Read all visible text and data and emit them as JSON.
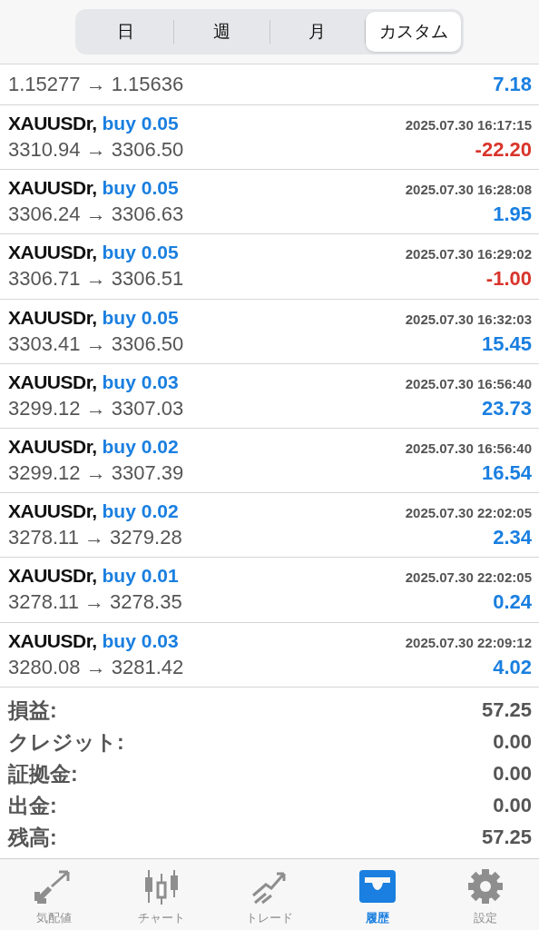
{
  "tabs": [
    {
      "label": "日",
      "selected": false
    },
    {
      "label": "週",
      "selected": false
    },
    {
      "label": "月",
      "selected": false
    },
    {
      "label": "カスタム",
      "selected": true
    }
  ],
  "deals": [
    {
      "prices": "1.15277 → 1.15636",
      "profit": "7.18",
      "color": "#1a7fe0"
    },
    {
      "symbol": "XAUUSDr,",
      "order": "buy 0.05",
      "time": "2025.07.30 16:17:15",
      "prices": "3310.94 → 3306.50",
      "profit": "-22.20",
      "color": "#d9342b"
    },
    {
      "symbol": "XAUUSDr,",
      "order": "buy 0.05",
      "time": "2025.07.30 16:28:08",
      "prices": "3306.24 → 3306.63",
      "profit": "1.95",
      "color": "#1a7fe0"
    },
    {
      "symbol": "XAUUSDr,",
      "order": "buy 0.05",
      "time": "2025.07.30 16:29:02",
      "prices": "3306.71 → 3306.51",
      "profit": "-1.00",
      "color": "#d9342b"
    },
    {
      "symbol": "XAUUSDr,",
      "order": "buy 0.05",
      "time": "2025.07.30 16:32:03",
      "prices": "3303.41 → 3306.50",
      "profit": "15.45",
      "color": "#1a7fe0"
    },
    {
      "symbol": "XAUUSDr,",
      "order": "buy 0.03",
      "time": "2025.07.30 16:56:40",
      "prices": "3299.12 → 3307.03",
      "profit": "23.73",
      "color": "#1a7fe0"
    },
    {
      "symbol": "XAUUSDr,",
      "order": "buy 0.02",
      "time": "2025.07.30 16:56:40",
      "prices": "3299.12 → 3307.39",
      "profit": "16.54",
      "color": "#1a7fe0"
    },
    {
      "symbol": "XAUUSDr,",
      "order": "buy 0.02",
      "time": "2025.07.30 22:02:05",
      "prices": "3278.11 → 3279.28",
      "profit": "2.34",
      "color": "#1a7fe0"
    },
    {
      "symbol": "XAUUSDr,",
      "order": "buy 0.01",
      "time": "2025.07.30 22:02:05",
      "prices": "3278.11 → 3278.35",
      "profit": "0.24",
      "color": "#1a7fe0"
    },
    {
      "symbol": "XAUUSDr,",
      "order": "buy 0.03",
      "time": "2025.07.30 22:09:12",
      "prices": "3280.08 → 3281.42",
      "profit": "4.02",
      "color": "#1a7fe0"
    }
  ],
  "summary": [
    {
      "label": "損益:",
      "value": "57.25"
    },
    {
      "label": "クレジット:",
      "value": "0.00"
    },
    {
      "label": "証拠金:",
      "value": "0.00"
    },
    {
      "label": "出金:",
      "value": "0.00"
    },
    {
      "label": "残高:",
      "value": "57.25"
    }
  ],
  "nav": [
    {
      "label": "気配値",
      "selected": false
    },
    {
      "label": "チャート",
      "selected": false
    },
    {
      "label": "トレード",
      "selected": false
    },
    {
      "label": "履歴",
      "selected": true
    },
    {
      "label": "設定",
      "selected": false
    }
  ]
}
